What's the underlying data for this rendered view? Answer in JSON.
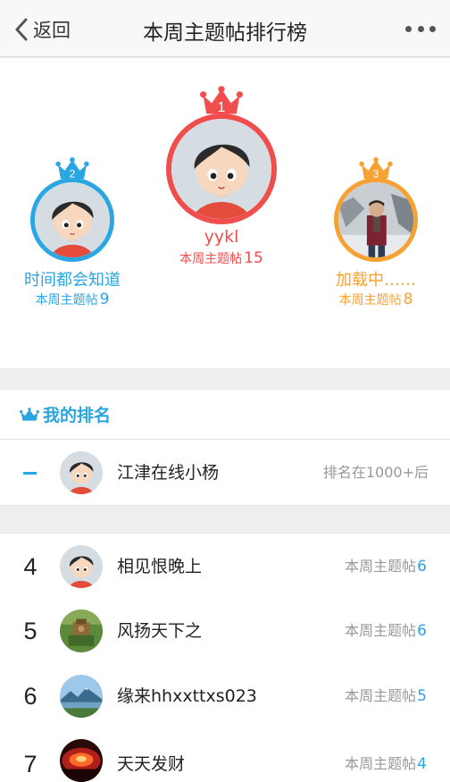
{
  "nav": {
    "back_label": "返回",
    "title": "本周主题帖排行榜",
    "more_icon": "more-dots-icon"
  },
  "podium": {
    "first": {
      "rank": "1",
      "name": "yykl",
      "count_label": "本周主题帖",
      "count": "15",
      "color": "#f04d4d"
    },
    "second": {
      "rank": "2",
      "name": "时间都会知道",
      "count_label": "本周主题帖",
      "count": "9",
      "color": "#2aa6e3"
    },
    "third": {
      "rank": "3",
      "name": "加载中……",
      "count_label": "本周主题帖",
      "count": "8",
      "color": "#f6a233"
    }
  },
  "my_rank": {
    "title": "我的排名",
    "icon": "crown-icon",
    "name": "江津在线小杨",
    "status": "排名在1000+后"
  },
  "list": [
    {
      "rank": "4",
      "name": "相见恨晚上",
      "count_label": "本周主题帖",
      "count": "6"
    },
    {
      "rank": "5",
      "name": "风扬天下之",
      "count_label": "本周主题帖",
      "count": "6"
    },
    {
      "rank": "6",
      "name": "缘来hhxxttxs023",
      "count_label": "本周主题帖",
      "count": "5"
    },
    {
      "rank": "7",
      "name": "天天发财",
      "count_label": "本周主题帖",
      "count": "4"
    }
  ],
  "colors": {
    "accent": "#29a4e0",
    "gold": "#f6a233",
    "red": "#f04d4d"
  }
}
